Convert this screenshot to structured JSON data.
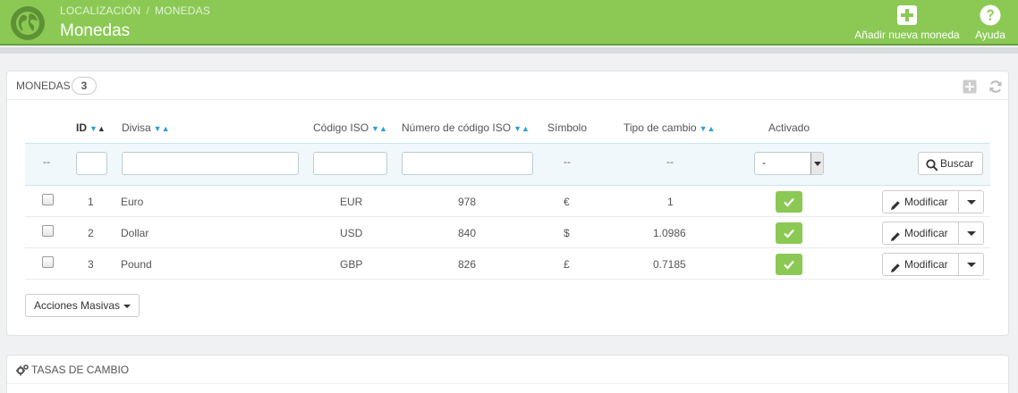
{
  "header": {
    "breadcrumb": [
      "LOCALIZACIÓN",
      "MONEDAS"
    ],
    "breadcrumb_sep": "/",
    "title": "Monedas",
    "actions": [
      {
        "label": "Añadir nueva moneda",
        "icon": "plus-square-icon"
      },
      {
        "label": "Ayuda",
        "icon": "help-circle-icon"
      }
    ],
    "accent_color": "#8bc954"
  },
  "panel": {
    "title": "MONEDAS",
    "count": "3",
    "columns": {
      "id": "ID",
      "divisa": "Divisa",
      "codigo_iso": "Código ISO",
      "numero_iso": "Número de código ISO",
      "simbolo": "Símbolo",
      "tipo_cambio": "Tipo de cambio",
      "activado": "Activado"
    },
    "filters": {
      "checkbox_dash": "--",
      "simbolo_dash": "--",
      "tipo_dash": "--",
      "activado_value": "-",
      "search_label": "Buscar"
    },
    "rows": [
      {
        "id": "1",
        "divisa": "Euro",
        "iso": "EUR",
        "num": "978",
        "simbolo": "€",
        "tipo": "1",
        "activado": true,
        "edit": "Modificar"
      },
      {
        "id": "2",
        "divisa": "Dollar",
        "iso": "USD",
        "num": "840",
        "simbolo": "$",
        "tipo": "1.0986",
        "activado": true,
        "edit": "Modificar"
      },
      {
        "id": "3",
        "divisa": "Pound",
        "iso": "GBP",
        "num": "826",
        "simbolo": "£",
        "tipo": "0.7185",
        "activado": true,
        "edit": "Modificar"
      }
    ],
    "bulk_label": "Acciones Masivas"
  },
  "panel2": {
    "title": "TASAS DE CAMBIO",
    "icon": "cogs-icon"
  }
}
